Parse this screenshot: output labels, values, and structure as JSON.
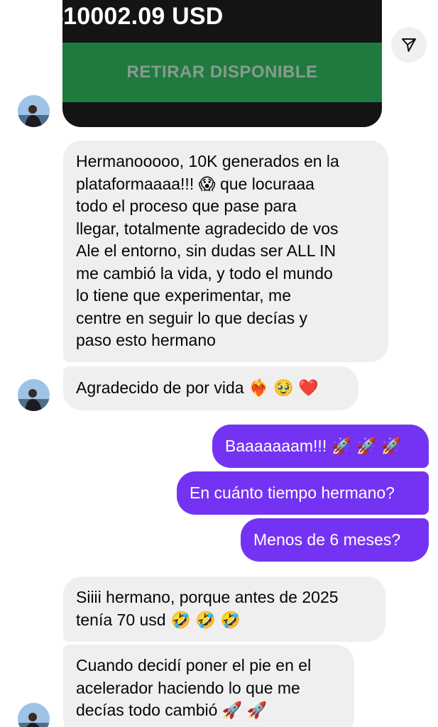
{
  "shared_post": {
    "amount": "10002.09 USD",
    "amount_prefix": "$",
    "withdraw_label": "RETIRAR DISPONIBLE"
  },
  "icons": {
    "share": "send-icon",
    "avatar": "contact-avatar"
  },
  "colors": {
    "outgoing_bubble": "#7433f3",
    "incoming_bubble": "#efefef",
    "withdraw_button": "#1f7a3e"
  },
  "messages": [
    {
      "direction": "incoming",
      "lines": [
        "Hermanooooo, 10K generados en la",
        "plataformaaaa!!! 😱 que locuraaa",
        "todo el proceso que pase para",
        "llegar, totalmente agradecido de vos",
        "Ale el entorno, sin dudas ser ALL IN",
        "me cambió la vida, y todo el mundo",
        "lo tiene que experimentar, me",
        "centre en seguir lo que decías y",
        "paso esto hermano"
      ]
    },
    {
      "direction": "incoming",
      "lines": [
        "Agradecido de por vida ❤️‍🔥 🥹 ❤️"
      ]
    },
    {
      "direction": "outgoing",
      "lines": [
        "Baaaaaaam!!! 🚀 🚀 🚀"
      ]
    },
    {
      "direction": "outgoing",
      "lines": [
        "En cuánto tiempo hermano?"
      ]
    },
    {
      "direction": "outgoing",
      "lines": [
        "Menos de 6 meses?"
      ]
    },
    {
      "direction": "incoming",
      "lines": [
        "Siiii hermano, porque antes de 2025",
        "tenía 70 usd 🤣 🤣 🤣"
      ]
    },
    {
      "direction": "incoming",
      "lines": [
        "Cuando decidí poner el pie en el",
        "acelerador haciendo lo que me",
        "decías todo cambió 🚀 🚀"
      ]
    }
  ]
}
